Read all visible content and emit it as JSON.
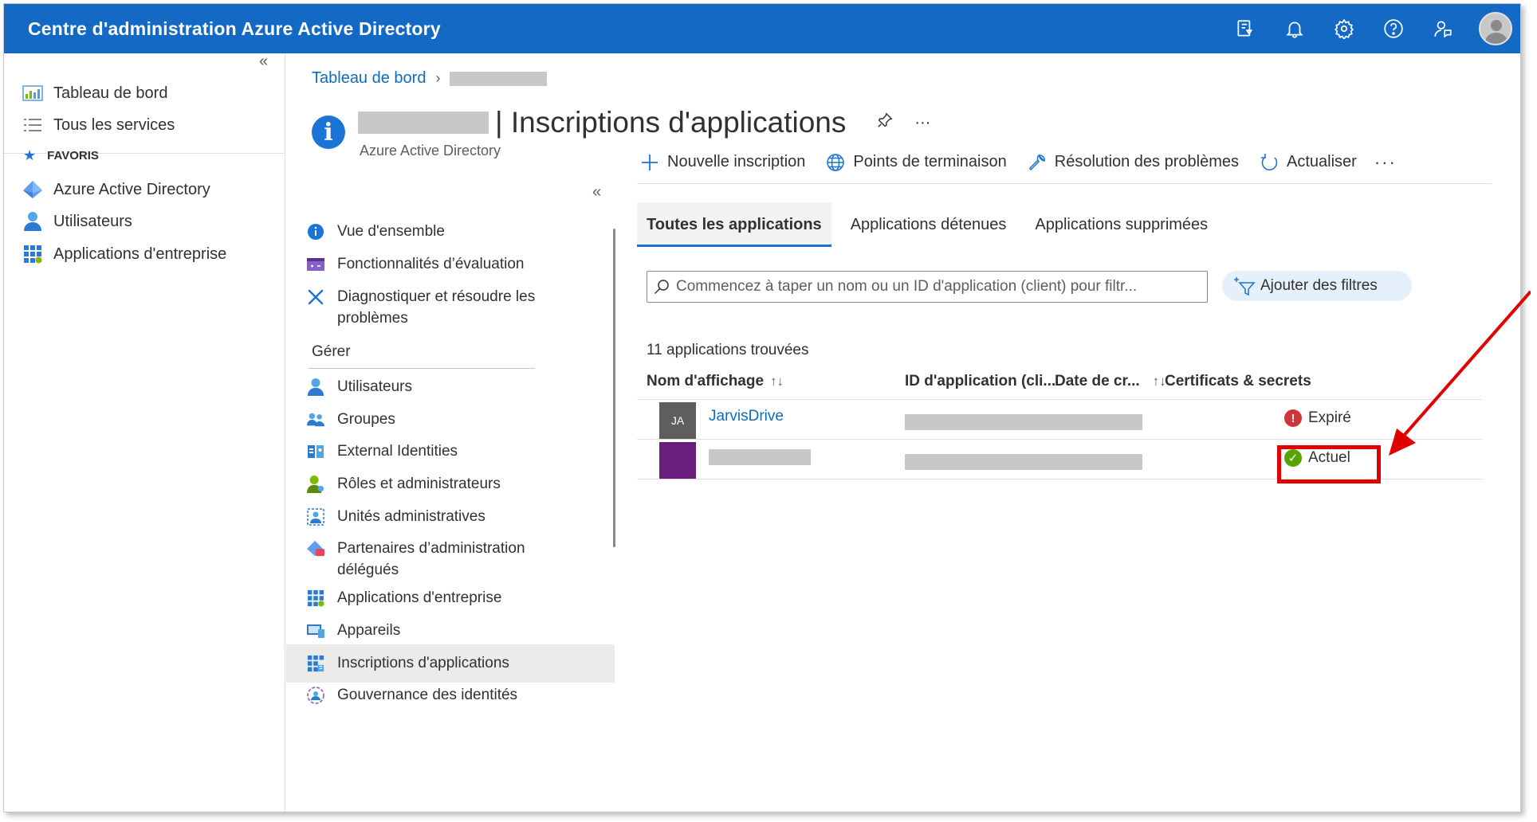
{
  "topbar": {
    "title": "Centre d'administration Azure Active Directory",
    "icons": [
      "portal-settings-icon",
      "bell-icon",
      "gear-icon",
      "help-icon",
      "feedback-icon"
    ]
  },
  "leftnav": {
    "items": [
      {
        "label": "Tableau de bord",
        "icon": "dashboard-icon"
      },
      {
        "label": "Tous les services",
        "icon": "list-icon"
      }
    ],
    "favorites_label": "FAVORIS",
    "favorites": [
      {
        "label": "Azure Active Directory",
        "icon": "aad-icon"
      },
      {
        "label": "Utilisateurs",
        "icon": "user-icon"
      },
      {
        "label": "Applications d'entreprise",
        "icon": "enterprise-apps-icon"
      }
    ]
  },
  "breadcrumb": {
    "home": "Tableau de bord"
  },
  "header": {
    "title": "| Inscriptions d'applications",
    "subtitle": "Azure Active Directory",
    "more": "···"
  },
  "resmenu": {
    "items": [
      {
        "label": "Vue d'ensemble"
      },
      {
        "label": "Fonctionnalités d’évaluation"
      },
      {
        "label": "Diagnostiquer et résoudre les problèmes"
      }
    ],
    "section": "Gérer",
    "manage": [
      {
        "label": "Utilisateurs"
      },
      {
        "label": "Groupes"
      },
      {
        "label": "External Identities"
      },
      {
        "label": "Rôles et administrateurs"
      },
      {
        "label": "Unités administratives"
      },
      {
        "label": "Partenaires d’administration délégués"
      },
      {
        "label": "Applications d'entreprise"
      },
      {
        "label": "Appareils"
      },
      {
        "label": "Inscriptions d'applications"
      },
      {
        "label": "Gouvernance des identités"
      }
    ]
  },
  "commands": {
    "new": "Nouvelle inscription",
    "endpoints": "Points de terminaison",
    "troubleshoot": "Résolution des problèmes",
    "refresh": "Actualiser",
    "more": "···"
  },
  "tabs": [
    {
      "label": "Toutes les applications",
      "active": true
    },
    {
      "label": "Applications détenues",
      "active": false
    },
    {
      "label": "Applications supprimées",
      "active": false
    }
  ],
  "search": {
    "placeholder": "Commencez à taper un nom ou un ID d'application (client) pour filtr..."
  },
  "filter_button": "Ajouter des filtres",
  "count_text": "11 applications trouvées",
  "table": {
    "columns": {
      "name": "Nom d'affichage",
      "appid": "ID d'application (cli...",
      "date": "Date de cr...",
      "certs": "Certificats & secrets"
    },
    "sort_glyph": "↑↓",
    "rows": [
      {
        "initials": "JA",
        "name": "JarvisDrive",
        "status": "Expiré",
        "status_color": "#d13438",
        "tile_color": "#605e5c"
      },
      {
        "initials": "",
        "name": "",
        "status": "Actuel",
        "status_color": "#57a300",
        "tile_color": "#6b1e7e"
      }
    ]
  },
  "colors": {
    "topbar": "#1469c4",
    "link": "#0f6cbd",
    "highlight": "#e00000"
  }
}
